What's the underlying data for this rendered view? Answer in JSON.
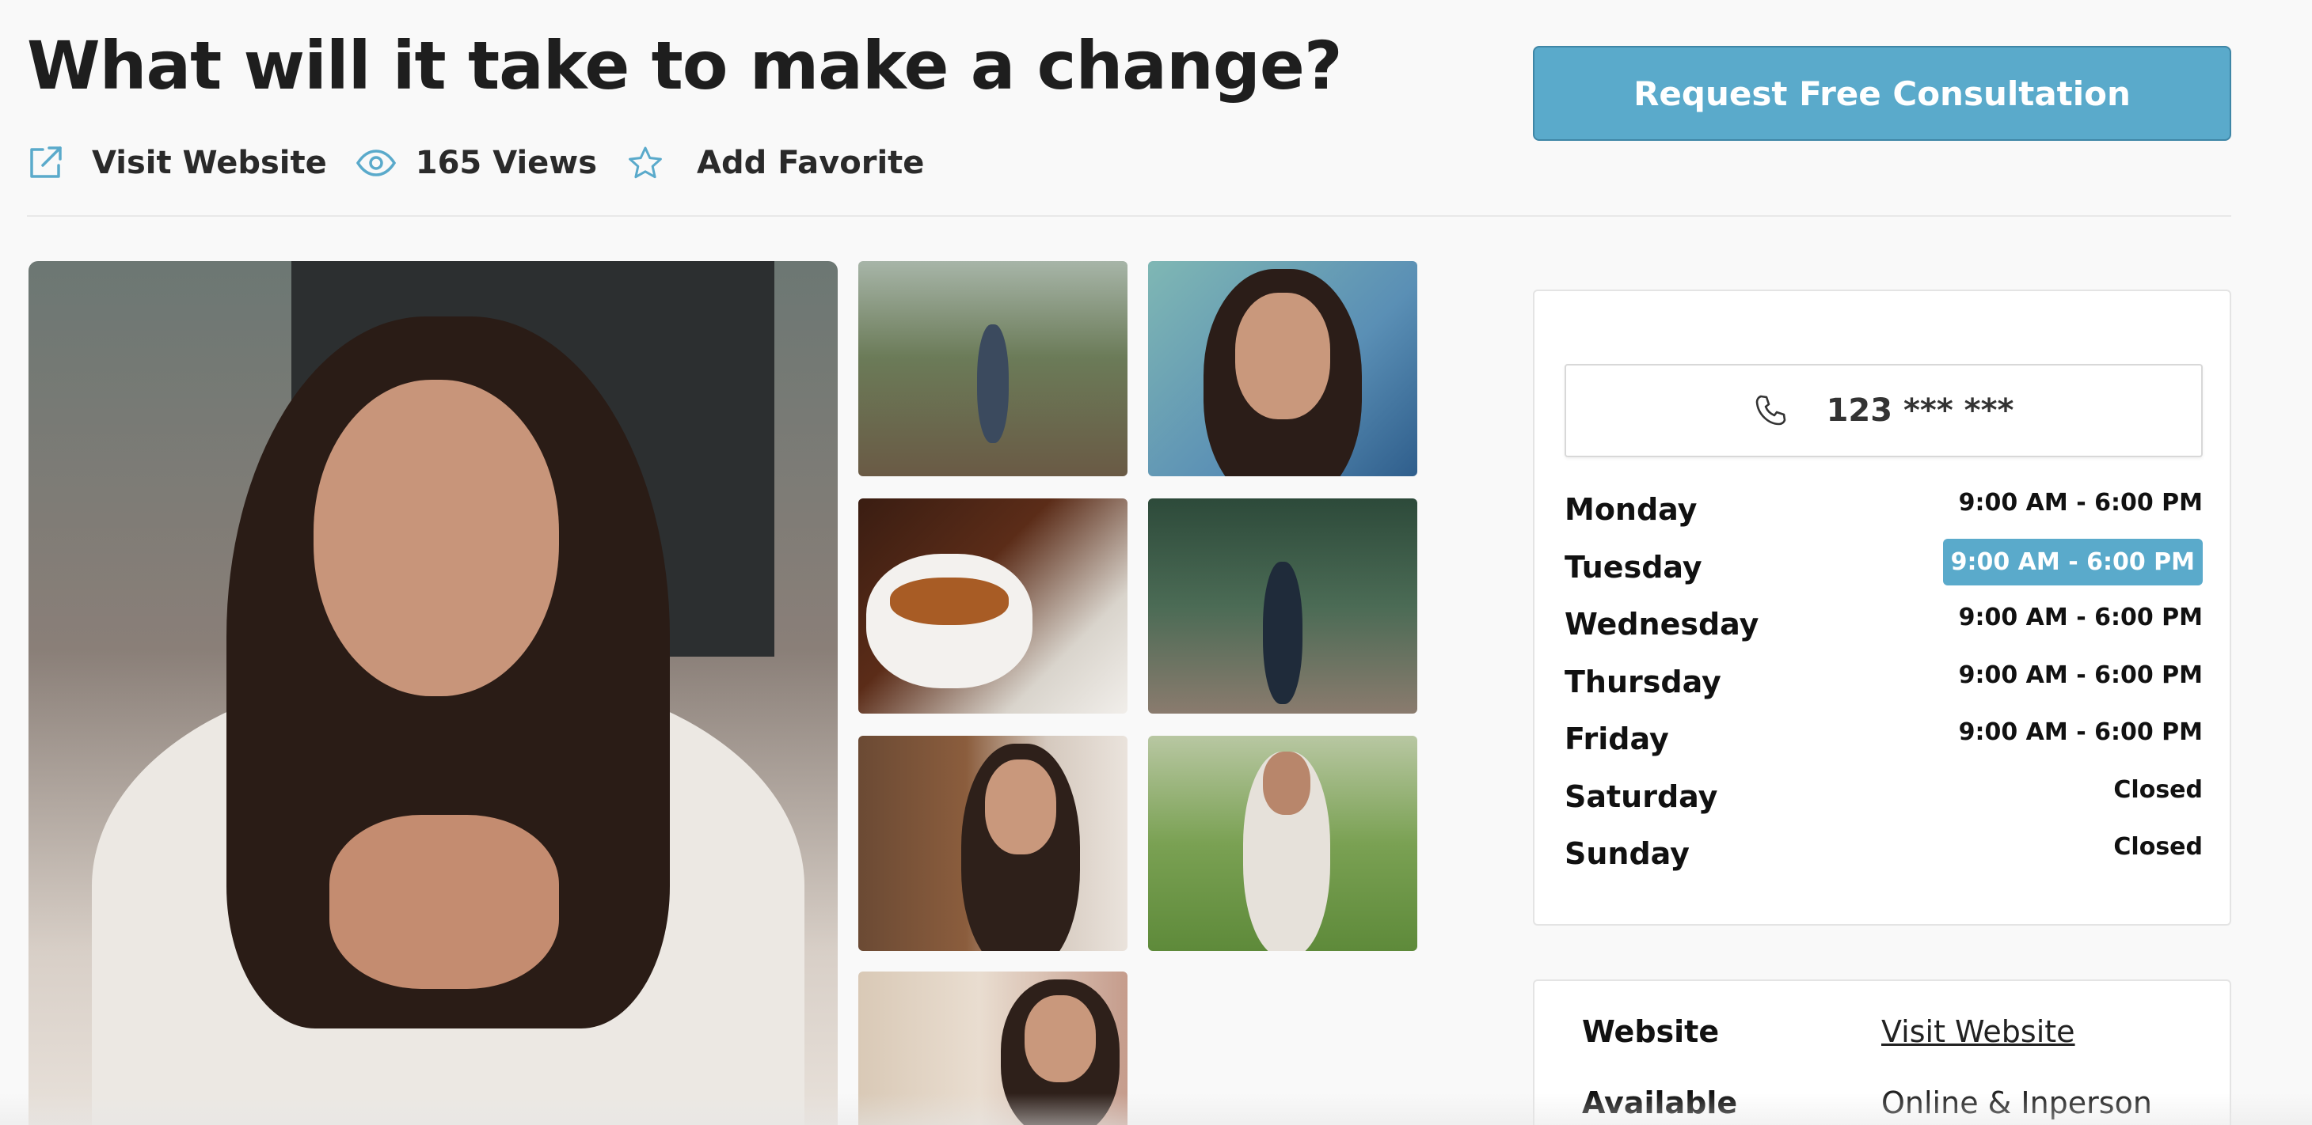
{
  "header": {
    "title": "What will it take to make a change?",
    "cta_label": "Request Free Consultation"
  },
  "meta": {
    "website_label": "Visit Website",
    "views_label": "165 Views",
    "favorite_label": "Add Favorite"
  },
  "contact": {
    "phone": "123 *** ***"
  },
  "hours": [
    {
      "day": "Monday",
      "time": "9:00 AM - 6:00 PM",
      "today": false
    },
    {
      "day": "Tuesday",
      "time": "9:00 AM - 6:00 PM",
      "today": true
    },
    {
      "day": "Wednesday",
      "time": "9:00 AM - 6:00 PM",
      "today": false
    },
    {
      "day": "Thursday",
      "time": "9:00 AM - 6:00 PM",
      "today": false
    },
    {
      "day": "Friday",
      "time": "9:00 AM - 6:00 PM",
      "today": false
    },
    {
      "day": "Saturday",
      "time": "Closed",
      "today": false
    },
    {
      "day": "Sunday",
      "time": "Closed",
      "today": false
    }
  ],
  "info": {
    "website_key": "Website",
    "website_value": "Visit Website",
    "available_key": "Available",
    "available_value": "Online & Inperson"
  },
  "colors": {
    "accent": "#5aaacb",
    "icon": "#5aaacb"
  },
  "icons": {
    "website": "external-link-icon",
    "views": "eye-icon",
    "favorite": "star-icon",
    "phone": "phone-icon"
  }
}
